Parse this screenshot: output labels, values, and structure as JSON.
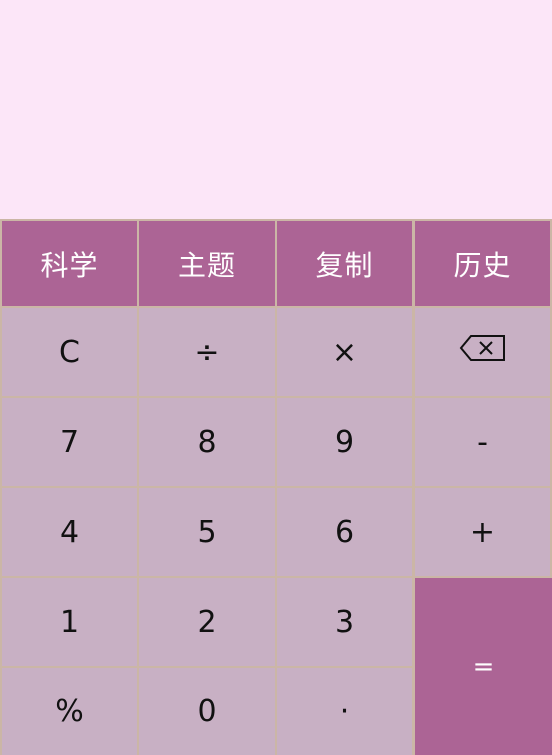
{
  "display": {
    "expression": ""
  },
  "top_row": {
    "science": "科学",
    "theme": "主题",
    "copy": "复制",
    "history": "历史"
  },
  "keys": {
    "clear": "C",
    "divide": "÷",
    "multiply": "×",
    "backspace_icon": "backspace-icon",
    "seven": "7",
    "eight": "8",
    "nine": "9",
    "minus": "-",
    "four": "4",
    "five": "5",
    "six": "6",
    "plus": "+",
    "one": "1",
    "two": "2",
    "three": "3",
    "equals": "=",
    "percent": "%",
    "zero": "0",
    "dot": "·"
  },
  "colors": {
    "display_bg": "#fce6f8",
    "accent": "#ac6495",
    "key_bg": "#c8b0c4",
    "divider": "#cbb6a6"
  }
}
